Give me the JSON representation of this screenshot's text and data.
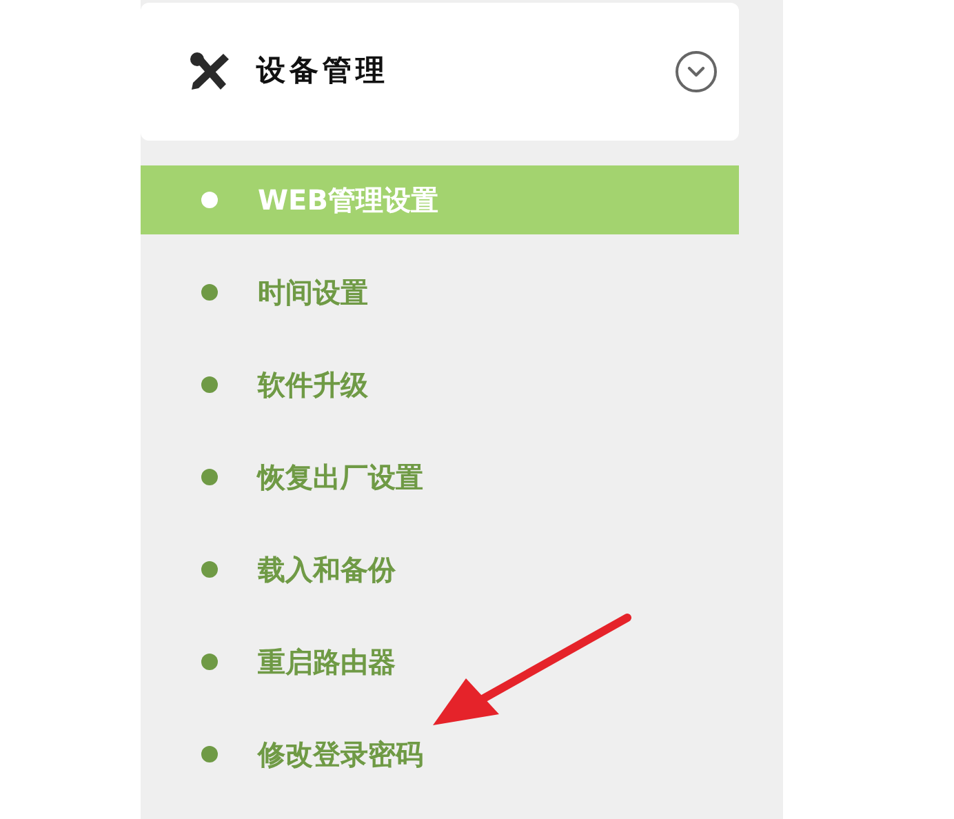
{
  "menu": {
    "title": "设备管理",
    "expanded": true,
    "items": [
      {
        "label": "WEB管理设置",
        "selected": true
      },
      {
        "label": "时间设置",
        "selected": false
      },
      {
        "label": "软件升级",
        "selected": false
      },
      {
        "label": "恢复出厂设置",
        "selected": false
      },
      {
        "label": "载入和备份",
        "selected": false
      },
      {
        "label": "重启路由器",
        "selected": false
      },
      {
        "label": "修改登录密码",
        "selected": false
      }
    ]
  }
}
